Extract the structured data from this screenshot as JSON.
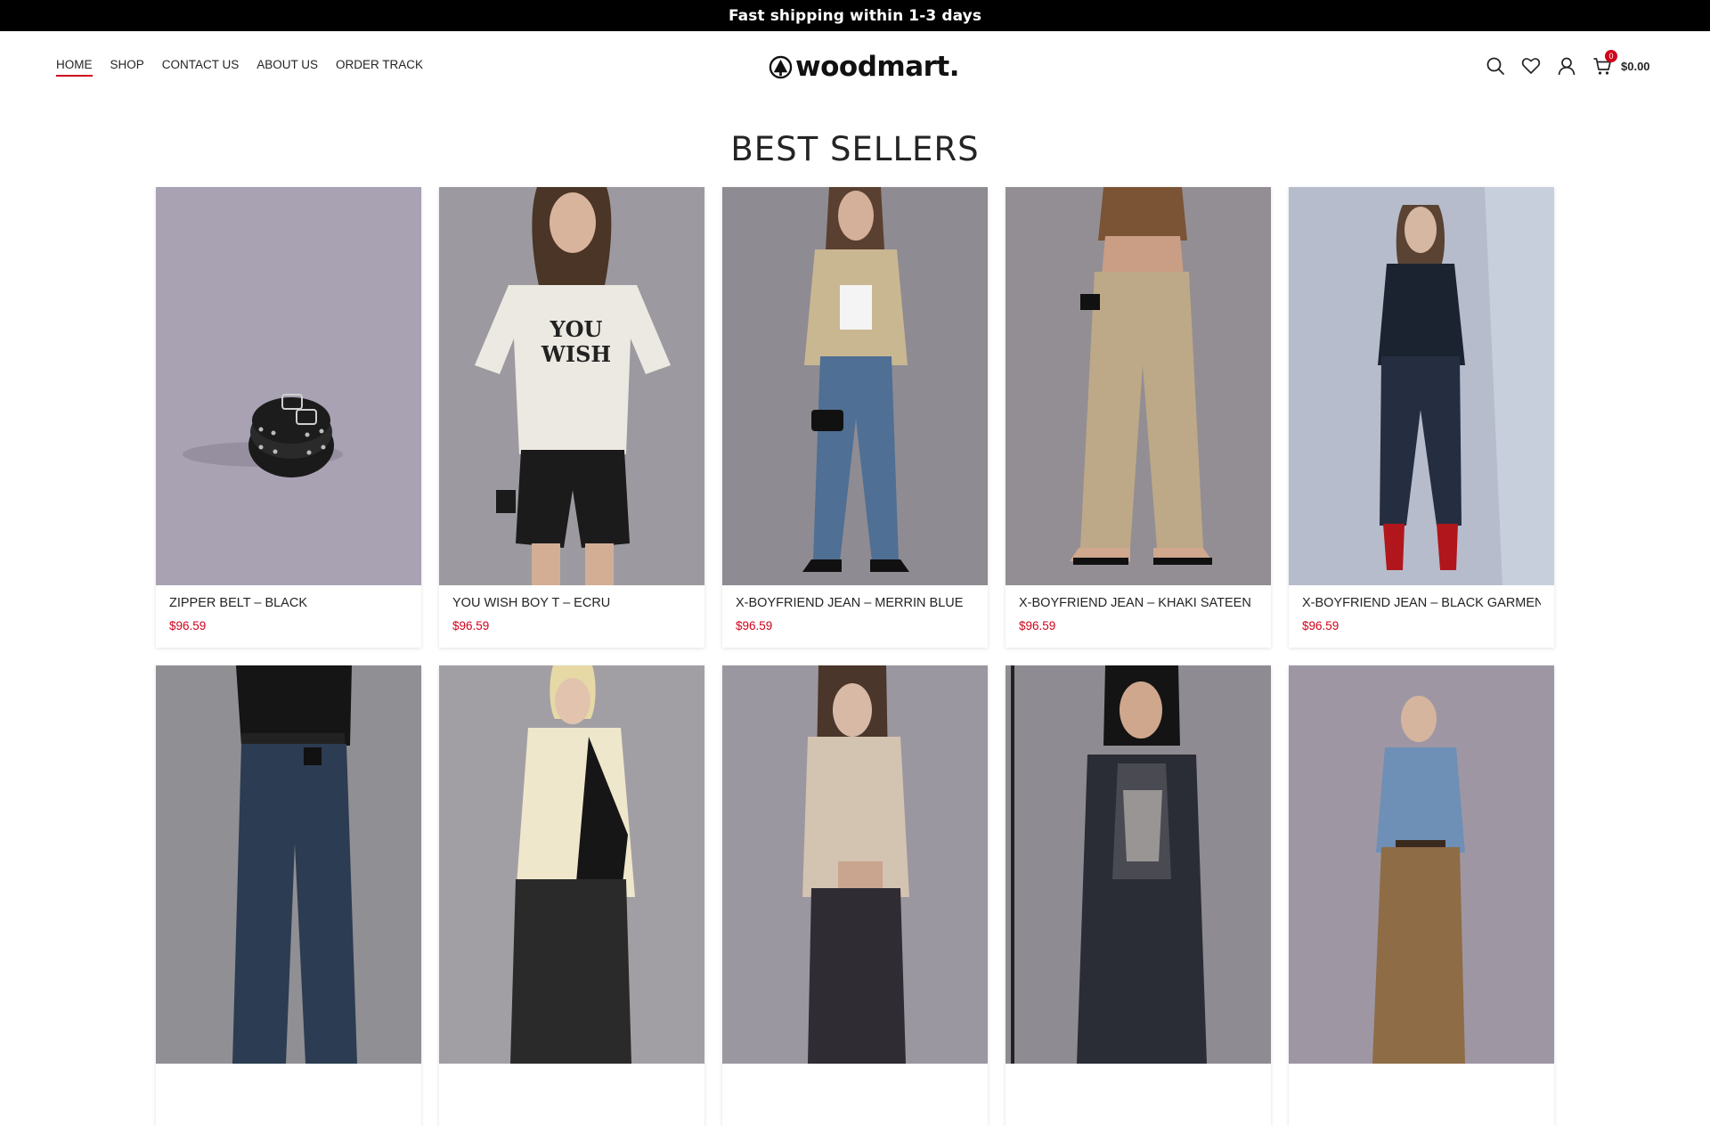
{
  "announcement": "Fast shipping within 1-3 days",
  "nav": [
    {
      "label": "HOME"
    },
    {
      "label": "SHOP"
    },
    {
      "label": "CONTACT US"
    },
    {
      "label": "ABOUT US"
    },
    {
      "label": "ORDER TRACK"
    }
  ],
  "logo": {
    "text": "woodmart."
  },
  "header": {
    "icons": [
      "search-icon",
      "heart-icon",
      "user-icon",
      "cart-icon"
    ],
    "cart_count": "0",
    "cart_total": "$0.00"
  },
  "section_title": "BEST SELLERS",
  "products": [
    {
      "title": "ZIPPER BELT – BLACK",
      "price": "$96.59"
    },
    {
      "title": "YOU WISH BOY T – ECRU",
      "price": "$96.59",
      "print": [
        "YOU",
        "WISH"
      ]
    },
    {
      "title": "X-BOYFRIEND JEAN – MERRIN BLUE",
      "price": "$96.59"
    },
    {
      "title": "X-BOYFRIEND JEAN – KHAKI SATEEN",
      "price": "$96.59"
    },
    {
      "title": "X-BOYFRIEND JEAN – BLACK GARMENT",
      "price": "$96.59"
    },
    {
      "title": "",
      "price": ""
    },
    {
      "title": "",
      "price": ""
    },
    {
      "title": "",
      "price": ""
    },
    {
      "title": "",
      "price": ""
    },
    {
      "title": "",
      "price": ""
    }
  ],
  "colors": {
    "accent": "#d0021b",
    "topbar": "#000000"
  }
}
